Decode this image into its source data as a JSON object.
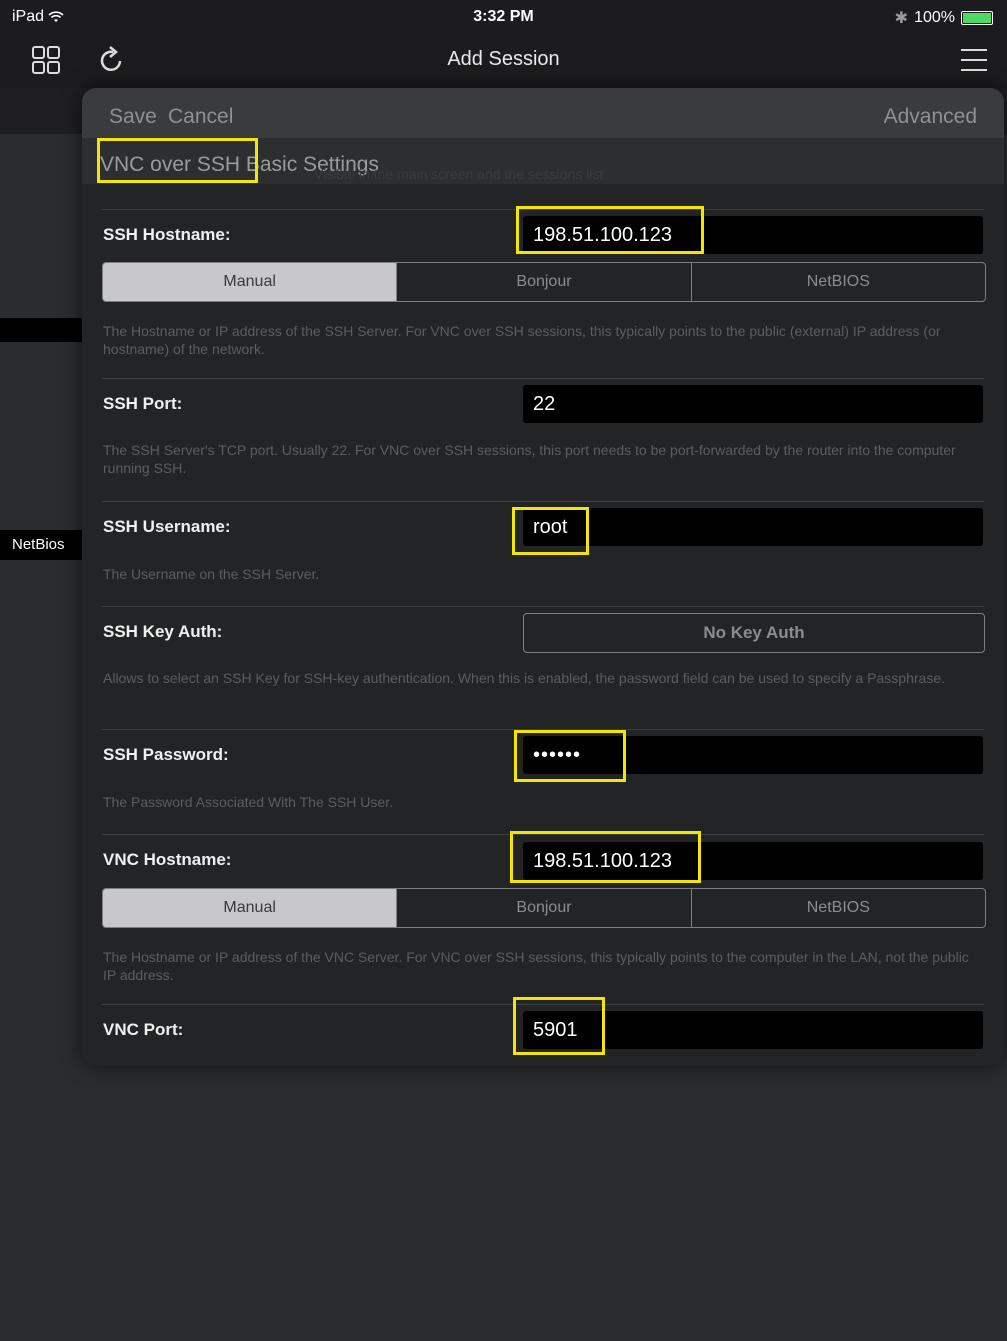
{
  "status": {
    "device": "iPad",
    "time": "3:32 PM",
    "battery": "100%"
  },
  "nav": {
    "title": "Add Session"
  },
  "background": {
    "netbios_label": "NetBios"
  },
  "modal": {
    "save": "Save",
    "cancel": "Cancel",
    "advanced": "Advanced",
    "header": "VNC over SSH Basic Settings",
    "header_sub": "Visible in the main screen and the sessions list"
  },
  "fields": {
    "ssh_hostname": {
      "label": "SSH Hostname:",
      "value": "198.51.100.123",
      "options": [
        "Manual",
        "Bonjour",
        "NetBIOS"
      ],
      "selected": "Manual",
      "desc": "The Hostname or IP address of the SSH Server. For VNC over SSH sessions, this typically points to the public (external) IP address (or hostname) of the network."
    },
    "ssh_port": {
      "label": "SSH Port:",
      "value": "22",
      "desc": "The SSH Server's TCP port. Usually 22. For VNC over SSH sessions, this port needs to be port-forwarded by the router into the computer running SSH."
    },
    "ssh_username": {
      "label": "SSH Username:",
      "value": "root",
      "desc": "The Username on the SSH Server."
    },
    "ssh_key_auth": {
      "label": "SSH Key Auth:",
      "value": "No Key Auth",
      "desc": "Allows to select an SSH Key for SSH-key authentication. When this is enabled, the password field can be used to specify a Passphrase."
    },
    "ssh_password": {
      "label": "SSH Password:",
      "value": "••••••",
      "desc": "The Password Associated With The SSH User."
    },
    "vnc_hostname": {
      "label": "VNC Hostname:",
      "value": "198.51.100.123",
      "options": [
        "Manual",
        "Bonjour",
        "NetBIOS"
      ],
      "selected": "Manual",
      "desc": "The Hostname or IP address of the VNC Server. For VNC over SSH sessions, this typically points to the computer in the LAN, not the public IP address."
    },
    "vnc_port": {
      "label": "VNC Port:",
      "value": "5901"
    }
  },
  "colors": {
    "highlight": "#f4e600",
    "background": "#2b2c2e",
    "field": "#000000"
  },
  "icons": {
    "grid": "grid-icon",
    "refresh": "refresh-icon",
    "menu": "hamburger-menu-icon"
  }
}
